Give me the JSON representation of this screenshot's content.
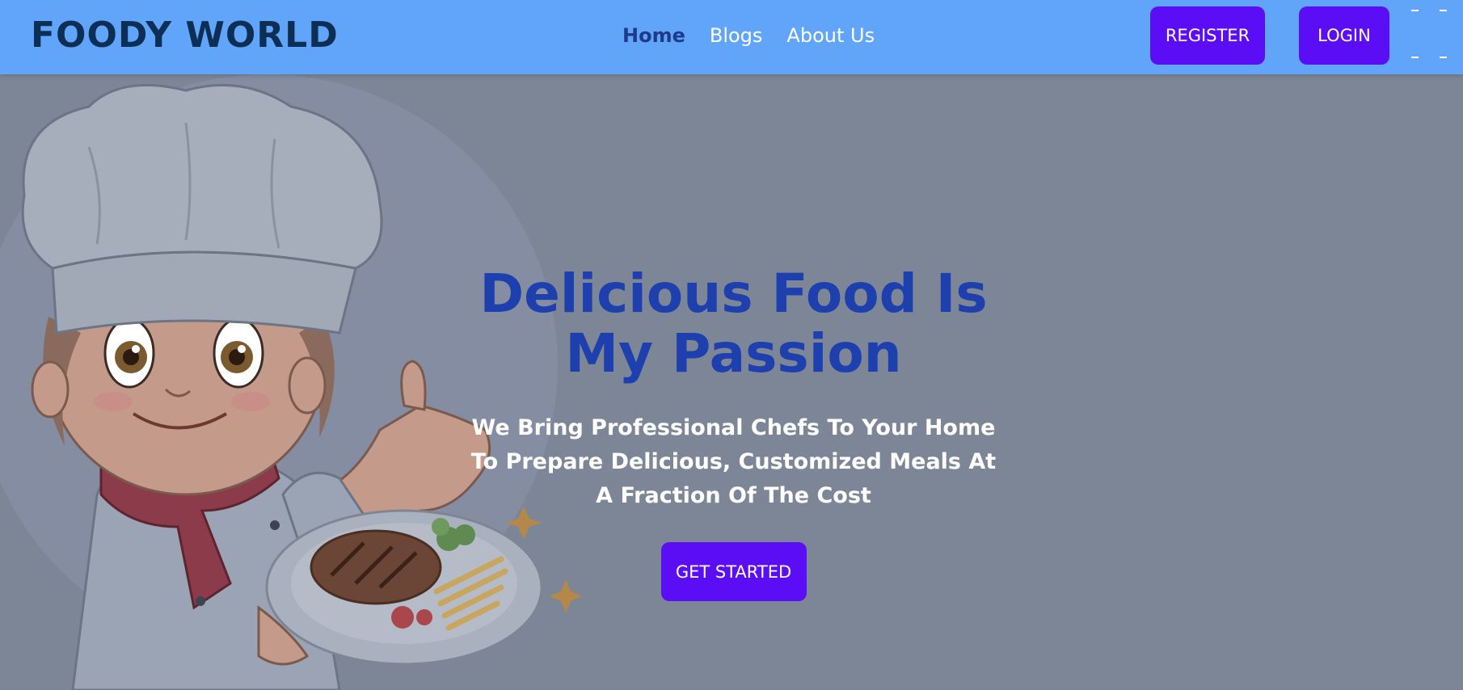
{
  "header": {
    "logo": "FOODY WORLD",
    "nav": [
      {
        "label": "Home",
        "active": true
      },
      {
        "label": "Blogs",
        "active": false
      },
      {
        "label": "About Us",
        "active": false
      }
    ],
    "register_label": "REGISTER",
    "login_label": "LOGIN",
    "menu_icon": "hamburger-menu-icon"
  },
  "hero": {
    "title_line1": "Delicious Food Is",
    "title_line2": "My Passion",
    "subtitle": "We Bring Professional Chefs To Your Home To Prepare Delicious, Customized Meals At A Fraction Of The Cost",
    "cta_label": "GET STARTED",
    "illustration": "chef-holding-steak-plate-illustration"
  },
  "colors": {
    "navbar": "#60a5fa",
    "logo": "#0d2f56",
    "button": "#5b0ef6",
    "title": "#1e40af",
    "hero_overlay": "#7d8696"
  }
}
